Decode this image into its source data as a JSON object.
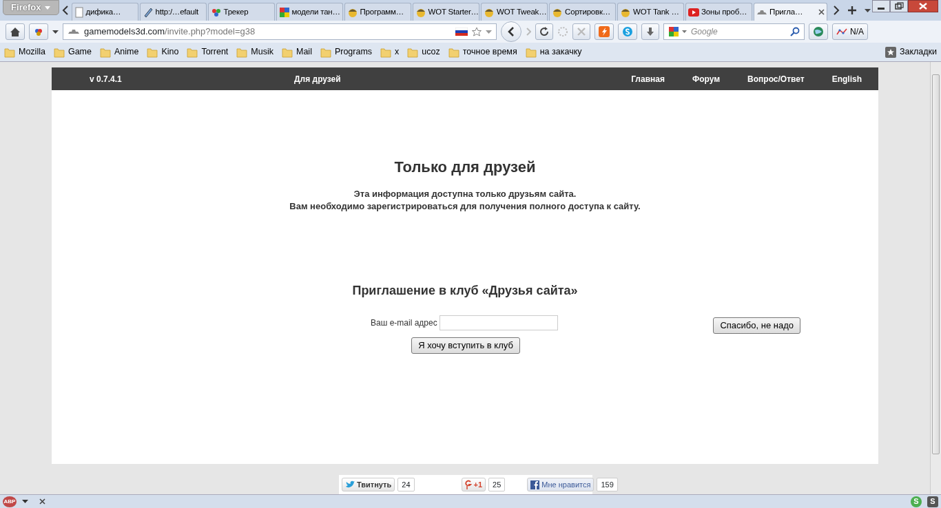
{
  "browser": {
    "menu_button": "Firefox",
    "tabs": [
      {
        "label": "дифика…",
        "selected": false
      },
      {
        "label": "http:/…efault",
        "selected": false
      },
      {
        "label": "Трекер",
        "selected": false
      },
      {
        "label": "модели тан…",
        "selected": false
      },
      {
        "label": "Программ…",
        "selected": false
      },
      {
        "label": "WOT Starter…",
        "selected": false
      },
      {
        "label": "WOT Tweak…",
        "selected": false
      },
      {
        "label": "Сортировк…",
        "selected": false
      },
      {
        "label": "WOT Tank …",
        "selected": false
      },
      {
        "label": "Зоны проб…",
        "selected": false
      },
      {
        "label": "Пригла…",
        "selected": true
      }
    ],
    "url": {
      "host": "gamemodels3d.com",
      "path": "/invite.php?model=g38"
    },
    "search": {
      "placeholder": "Google"
    },
    "rank_reading": "N/A",
    "bookmarks": [
      "Mozilla",
      "Game",
      "Anime",
      "Kino",
      "Torrent",
      "Musik",
      "Mail",
      "Programs",
      "x",
      "ucoz",
      "точное время",
      "на закачку"
    ],
    "bookmarks_menu": "Закладки",
    "status_icons": {
      "adblock": "ABP",
      "skype_green": "S",
      "skype_grey": "S"
    }
  },
  "site": {
    "version": "v 0.7.4.1",
    "section_title": "Для друзей",
    "nav": [
      "Главная",
      "Форум",
      "Вопрос/Ответ",
      "English"
    ],
    "heading": "Только для друзей",
    "message": [
      "Эта информация доступна только друзьям сайта.",
      "Вам необходимо зарегистрироваться для получения полного доступа к сайту."
    ],
    "invite_heading": "Приглашение в клуб «Друзья сайта»",
    "email": {
      "label": "Ваш e-mail адрес"
    },
    "join_button": "Я хочу вступить в клуб",
    "decline_button": "Спасибо, не надо",
    "social": [
      {
        "kind": "twitter",
        "label": "Твитнуть",
        "count": "24"
      },
      {
        "kind": "gplus",
        "label": "+1",
        "count": "25"
      },
      {
        "kind": "facebook",
        "label": "Мне нравится",
        "count": "159"
      }
    ]
  }
}
